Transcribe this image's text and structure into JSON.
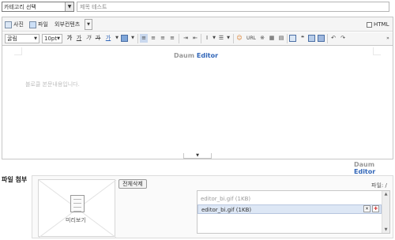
{
  "category": {
    "selected": "카테고리 선택"
  },
  "title_input": {
    "value": "제목 테스트"
  },
  "toolbar1": {
    "photo": "사진",
    "file": "파일",
    "external": "외부컨텐츠",
    "html": "HTML"
  },
  "toolbar2": {
    "font": "굴림",
    "size": "10pt",
    "bold": "가",
    "underline": "가",
    "italic": "가",
    "strike": "가",
    "color": "가",
    "url": "URL",
    "special": "※"
  },
  "editor": {
    "brand_gray": "Daum",
    "brand_blue": "Editor",
    "placeholder": "블로클 본문내용입니다.",
    "footer_brand_gray": "Daum",
    "footer_brand_blue": "Editor"
  },
  "attachment": {
    "section_title": "파일 첨부",
    "delete_all": "전체삭제",
    "file_label": "파일: /",
    "preview_label": "미리보기",
    "files": [
      {
        "name": "editor_bi.gif (1KB)"
      },
      {
        "name": "editor_bi.gif (1KB)"
      }
    ]
  }
}
